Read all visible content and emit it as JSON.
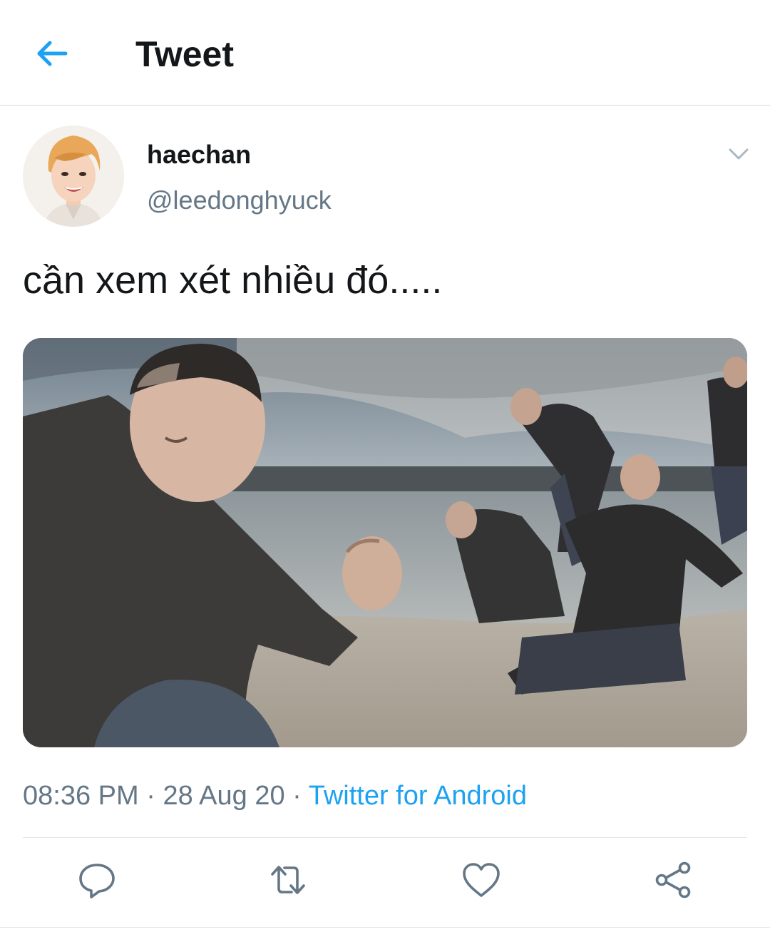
{
  "header": {
    "title": "Tweet",
    "back_icon": "arrow-left-icon"
  },
  "tweet": {
    "author": {
      "display_name": "haechan",
      "handle": "@leedonghyuck"
    },
    "text": "cần xem xét nhiều đó.....",
    "time": "08:36 PM",
    "separator": "·",
    "date": "28 Aug 20",
    "source": "Twitter for Android",
    "media": {
      "type": "photo",
      "description_icon": "meme-photo"
    }
  },
  "actions": [
    {
      "name": "reply",
      "icon": "reply-icon"
    },
    {
      "name": "retweet",
      "icon": "retweet-icon"
    },
    {
      "name": "like",
      "icon": "heart-icon"
    },
    {
      "name": "share",
      "icon": "share-icon"
    }
  ],
  "colors": {
    "accent": "#1da1f2",
    "secondary_text": "#657786",
    "icon_gray": "#657786",
    "divider": "#e1e8ed"
  }
}
